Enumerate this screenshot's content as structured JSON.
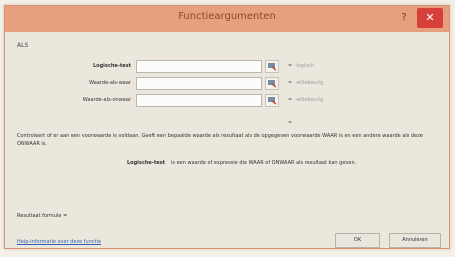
{
  "dialog": {
    "title": "Functieargumenten",
    "help_label": "?",
    "close_label": "✕"
  },
  "function_name": "ALS",
  "arguments": [
    {
      "label": "Logische-test",
      "result": "logisch"
    },
    {
      "label": "Waarde-als-waar",
      "result": "willekeurig"
    },
    {
      "label": "Waarde-als-onwaar",
      "result": "willekeurig"
    }
  ],
  "result_prefix": "=",
  "more_results": "=",
  "description": "Controleert of er aan een voorwaarde is voldaan. Geeft een bepaalde waarde als resultaat als de opgegeven voorwaarde WAAR is en een andere waarde als deze ONWAAR is.",
  "argument_description": {
    "name": "Logische-test",
    "text": "is een waarde of expressie die WAAR of ONWAAR als resultaat kan geven."
  },
  "formula_result": "Resultaat formule =",
  "help_link": "Help-informatie over deze functie",
  "buttons": {
    "ok": "OK",
    "cancel": "Annuleren"
  }
}
